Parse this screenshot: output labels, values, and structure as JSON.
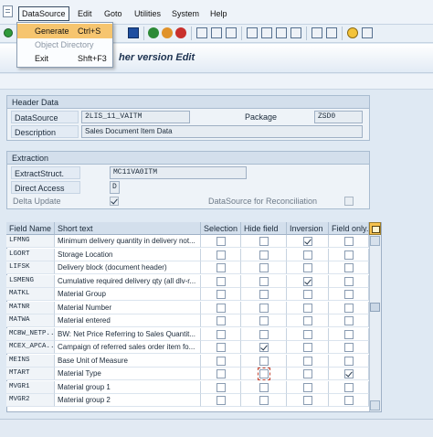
{
  "menubar": {
    "items": [
      "DataSource",
      "Edit",
      "Goto",
      "Utilities",
      "System",
      "Help"
    ]
  },
  "dropdown": {
    "items": [
      {
        "label": "Generate",
        "shortcut": "Ctrl+S",
        "state": "highlighted"
      },
      {
        "label": "Object Directory",
        "shortcut": "",
        "state": "disabled"
      },
      {
        "label": "Exit",
        "shortcut": "Shft+F3",
        "state": "normal"
      }
    ]
  },
  "title": "her version Edit",
  "header": {
    "section_title": "Header Data",
    "datasource_label": "DataSource",
    "datasource_value": "2LIS_11_VAITM",
    "package_label": "Package",
    "package_value": "ZSD0",
    "description_label": "Description",
    "description_value": "Sales Document Item Data"
  },
  "extraction": {
    "section_title": "Extraction",
    "extractstruct_label": "ExtractStruct.",
    "extractstruct_value": "MC11VA0ITM",
    "direct_access_label": "Direct Access",
    "direct_access_value": "D",
    "delta_update_label": "Delta Update",
    "delta_update_checked": true,
    "reconciliation_label": "DataSource for Reconciliation",
    "reconciliation_checked": false
  },
  "table": {
    "columns": [
      "Field Name",
      "Short text",
      "Selection",
      "Hide field",
      "Inversion",
      "Field only..."
    ],
    "rows": [
      {
        "field": "LFMNG",
        "text": "Minimum delivery quantity in delivery not...",
        "selection": false,
        "hide": false,
        "inversion": true,
        "field_only": false
      },
      {
        "field": "LGORT",
        "text": "Storage Location",
        "selection": false,
        "hide": false,
        "inversion": false,
        "field_only": false
      },
      {
        "field": "LIFSK",
        "text": "Delivery block (document header)",
        "selection": false,
        "hide": false,
        "inversion": false,
        "field_only": false
      },
      {
        "field": "LSMENG",
        "text": "Cumulative required delivery qty (all dlv-r...",
        "selection": false,
        "hide": false,
        "inversion": true,
        "field_only": false
      },
      {
        "field": "MATKL",
        "text": "Material Group",
        "selection": false,
        "hide": false,
        "inversion": false,
        "field_only": false
      },
      {
        "field": "MATNR",
        "text": "Material Number",
        "selection": false,
        "hide": false,
        "inversion": false,
        "field_only": false
      },
      {
        "field": "MATWA",
        "text": "Material entered",
        "selection": false,
        "hide": false,
        "inversion": false,
        "field_only": false
      },
      {
        "field": "MCBW_NETP...",
        "text": "BW: Net Price Referring to Sales Quantit...",
        "selection": false,
        "hide": false,
        "inversion": false,
        "field_only": false
      },
      {
        "field": "MCEX_APCA...",
        "text": "Campaign of referred sales order item fo...",
        "selection": false,
        "hide": true,
        "inversion": false,
        "field_only": false
      },
      {
        "field": "MEINS",
        "text": "Base Unit of Measure",
        "selection": false,
        "hide": false,
        "inversion": false,
        "field_only": false
      },
      {
        "field": "MTART",
        "text": "Material Type",
        "selection": false,
        "hide": false,
        "inversion": false,
        "field_only": true
      },
      {
        "field": "MVGR1",
        "text": "Material group 1",
        "selection": false,
        "hide": false,
        "inversion": false,
        "field_only": false
      },
      {
        "field": "MVGR2",
        "text": "Material group 2",
        "selection": false,
        "hide": false,
        "inversion": false,
        "field_only": false
      }
    ]
  },
  "colors": {
    "highlight": "#f6c56f",
    "group_header": "#d3dfec",
    "background": "#dfe9f3"
  }
}
